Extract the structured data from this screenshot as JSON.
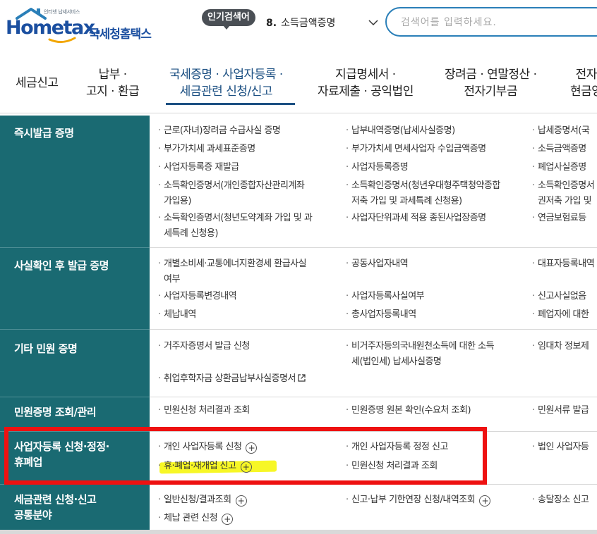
{
  "header": {
    "logo_small": "인터넷 납세서비스",
    "logo_text": "Hometax.",
    "logo_kr": "국세청홈택스",
    "popular_label": "인기검색어",
    "popular_num": "8.",
    "popular_value": "소득금액증명",
    "search_placeholder": "검색어를 입력하세요."
  },
  "gnb": {
    "items": [
      {
        "l1": "세금신고",
        "l2": ""
      },
      {
        "l1": "납부 ·",
        "l2": "고지 · 환급"
      },
      {
        "l1": "국세증명 · 사업자등록 ·",
        "l2": "세금관련 신청/신고"
      },
      {
        "l1": "지급명세서 ·",
        "l2": "자료제출 · 공익법인"
      },
      {
        "l1": "장려금 · 연말정산 ·",
        "l2": "전자기부금"
      },
      {
        "l1": "전자",
        "l2": "현금영"
      }
    ]
  },
  "sections": [
    {
      "title": "즉시발급 증명",
      "col1": [
        "근로(자녀)장려금 수급사실 증명",
        "부가가치세 과세표준증명",
        "사업자등록증 재발급",
        "소득확인증명서(개인종합자산관리계좌",
        "가입용)",
        "소득확인증명서(청년도약계좌 가입 및 과",
        "세특례 신청용)"
      ],
      "col2": [
        "납부내역증명(납세사실증명)",
        "부가가치세 면세사업자 수입금액증명",
        "사업자등록증명",
        "소득확인증명서(청년우대형주택청약종합",
        "저축 가입 및 과세특례 신청용)",
        "사업자단위과세 적용 종된사업장증명"
      ],
      "col3": [
        "납세증명서(국",
        "소득금액증명",
        "폐업사실증명",
        "소득확인증명서",
        "권저축 가입 및",
        "연금보험료등"
      ]
    },
    {
      "title": "사실확인 후 발급 증명",
      "col1": [
        "개별소비세·교통에너지환경세 환급사실",
        "여부",
        "사업자등록변경내역",
        "체납내역"
      ],
      "col2": [
        "공동사업자내역",
        "사업자등록사실여부",
        "총사업자등록내역"
      ],
      "col3": [
        "대표자등록내역",
        "신고사실없음",
        "폐업자에 대한"
      ]
    },
    {
      "title": "기타 민원 증명",
      "col1": [
        "거주자증명서 발급 신청",
        "취업후학자금 상환금납부사실증명서"
      ],
      "col2": [
        "비거주자등의국내원천소득에 대한 소득",
        "세(법인세) 납세사실증명"
      ],
      "col3": [
        "임대차 정보제"
      ]
    },
    {
      "title": "민원증명 조회/관리",
      "col1": [
        "민원신청 처리결과 조회"
      ],
      "col2": [
        "민원증명 원본 확인(수요처 조회)"
      ],
      "col3": [
        "민원서류 발급"
      ]
    },
    {
      "title_l1": "사업자등록 신청·정정·",
      "title_l2": "휴폐업",
      "col1": [
        "개인 사업자등록 신청",
        "휴·폐업·재개업 신고"
      ],
      "col2": [
        "개인 사업자등록 정정 신고",
        "민원신청 처리결과 조회"
      ],
      "col3": [
        "법인 사업자등"
      ]
    },
    {
      "title_l1": "세금관련 신청·신고",
      "title_l2": "공통분야",
      "col1": [
        "일반신청/결과조회",
        "체납 관련 신청"
      ],
      "col2": [
        "신고·납부 기한연장 신청/내역조회"
      ],
      "col3": [
        "송달장소 신고"
      ]
    }
  ],
  "colors": {
    "category_bg": "#1a6a72",
    "accent": "#1b4f82",
    "highlight_red": "#ee1111",
    "marker_yellow": "#f6f600"
  }
}
